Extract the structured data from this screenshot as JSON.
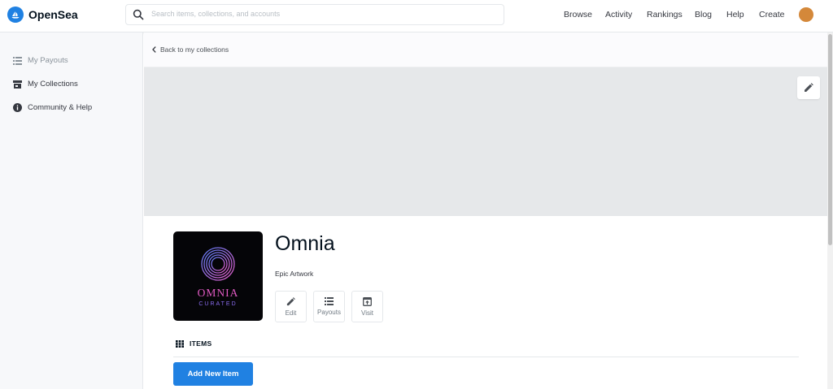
{
  "header": {
    "brand": "OpenSea",
    "search_placeholder": "Search items, collections, and accounts",
    "nav": [
      {
        "label": "Browse"
      },
      {
        "label": "Activity"
      },
      {
        "label": "Rankings"
      },
      {
        "label": "Blog"
      },
      {
        "label": "Help"
      },
      {
        "label": "Create"
      }
    ],
    "avatar_color": "#d4883a"
  },
  "sidebar": {
    "items": [
      {
        "label": "My Payouts",
        "icon": "list-icon",
        "muted": true
      },
      {
        "label": "My Collections",
        "icon": "storefront-icon",
        "muted": false
      },
      {
        "label": "Community & Help",
        "icon": "info-icon",
        "muted": false
      }
    ]
  },
  "main": {
    "back_label": "Back to my collections",
    "collection": {
      "name": "Omnia",
      "description": "Epic Artwork",
      "logo_line1": "OMNIA",
      "logo_line2": "CURATED"
    },
    "actions": [
      {
        "label": "Edit",
        "icon": "pencil-icon"
      },
      {
        "label": "Payouts",
        "icon": "list-icon"
      },
      {
        "label": "Visit",
        "icon": "external-icon"
      }
    ],
    "items_heading": "ITEMS",
    "add_button": "Add New Item"
  },
  "colors": {
    "accent": "#2081e2",
    "banner": "#e6e8ea",
    "sidebar_bg": "#f7f8fa"
  }
}
